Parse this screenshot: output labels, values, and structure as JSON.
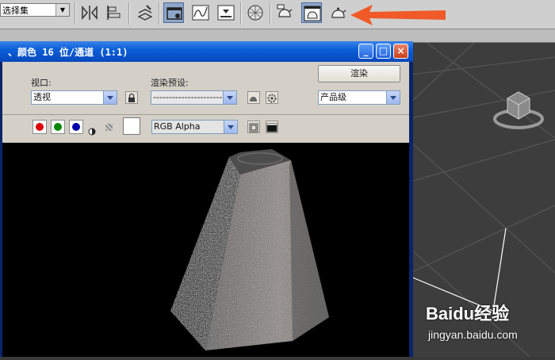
{
  "main_toolbar": {
    "selection_set": "选择集",
    "icons": [
      "mirror-icon",
      "align-icon",
      "layer-manager-icon",
      "scene-explorer-icon",
      "curve-editor-icon",
      "schematic-view-icon",
      "material-editor-icon",
      "render-setup-icon",
      "rendered-frame-window-icon",
      "render-production-icon"
    ]
  },
  "render_window": {
    "title": "、颜色 16 位/通道 (1:1)",
    "viewport_label": "视口:",
    "viewport_value": "透视",
    "preset_label": "渲染预设:",
    "preset_value": "--------------------------------",
    "render_button": "渲染",
    "render_quality": "产品级",
    "channel_value": "RGB Alpha",
    "window_buttons": {
      "minimize": "_",
      "maximize": "□",
      "close": "×"
    }
  },
  "colors": {
    "accent_arrow": "#f05a28",
    "titlebar": "#0a5fd8",
    "viewport_bg": "#3d3d3d"
  },
  "watermark": {
    "brand": "Baidu经验",
    "url": "jingyan.baidu.com"
  }
}
